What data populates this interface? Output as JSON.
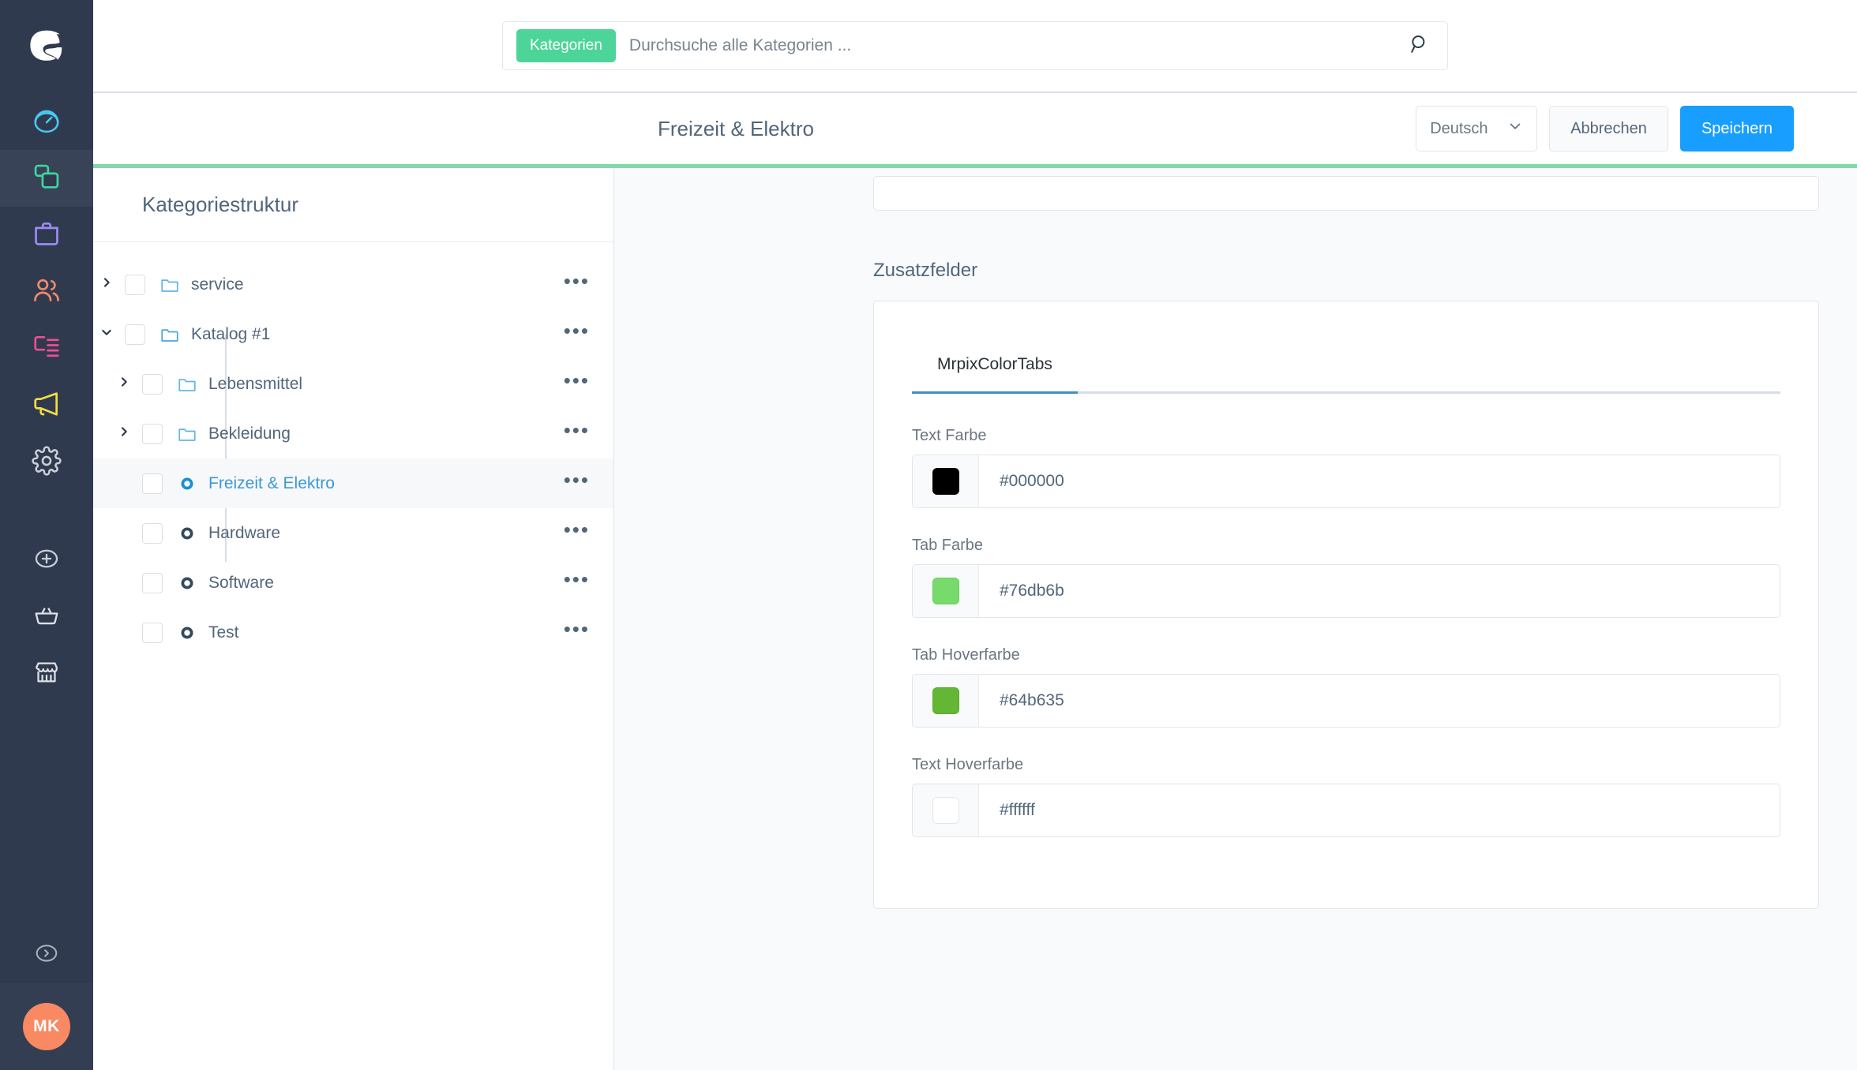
{
  "brand": {
    "logo_name": "shopware-logo",
    "accent_green": "#4dd599",
    "rule_green": "#86d7ac"
  },
  "sidebar": {
    "items": [
      {
        "name": "dashboard",
        "icon": "gauge-icon",
        "color": "#49c8f2",
        "active": false
      },
      {
        "name": "catalogues",
        "icon": "layers-icon",
        "color": "#3fd5a0",
        "active": true
      },
      {
        "name": "orders",
        "icon": "briefcase-icon",
        "color": "#9b8cf5",
        "active": false
      },
      {
        "name": "customers",
        "icon": "users-icon",
        "color": "#ef8b6a",
        "active": false
      },
      {
        "name": "content",
        "icon": "content-icon",
        "color": "#ec4e97",
        "active": false
      },
      {
        "name": "marketing",
        "icon": "megaphone-icon",
        "color": "#f2dd44",
        "active": false
      },
      {
        "name": "settings",
        "icon": "gear-icon",
        "color": "#c9cfd8",
        "active": false
      }
    ],
    "lower_items": [
      {
        "name": "extensions",
        "icon": "plus-circle-icon",
        "color": "#c9cfd8"
      },
      {
        "name": "basket",
        "icon": "basket-icon",
        "color": "#dde2e8"
      },
      {
        "name": "storefront",
        "icon": "shop-icon",
        "color": "#dde2e8"
      }
    ],
    "collapse": {
      "name": "collapse-sidebar",
      "icon": "chevron-right-circle-icon",
      "color": "#aab3c0"
    },
    "avatar": {
      "initials": "MK",
      "color": "#f88962"
    }
  },
  "search": {
    "chip_label": "Kategorien",
    "placeholder": "Durchsuche alle Kategorien ...",
    "value": "",
    "icon": "search-icon"
  },
  "smartbar": {
    "title": "Freizeit & Elektro",
    "language": {
      "value": "Deutsch",
      "caret": "chevron-down-icon"
    },
    "cancel_label": "Abbrechen",
    "save_label": "Speichern"
  },
  "tree": {
    "header_title": "Kategoriestruktur",
    "context_glyph": "•••",
    "rows": [
      {
        "label": "service",
        "depth": 0,
        "caret": "collapsed",
        "icon": "folder-icon",
        "selected": false
      },
      {
        "label": "Katalog #1",
        "depth": 0,
        "caret": "expanded",
        "icon": "folder-open-icon",
        "selected": false
      },
      {
        "label": "Lebensmittel",
        "depth": 1,
        "caret": "collapsed",
        "icon": "folder-icon",
        "selected": false
      },
      {
        "label": "Bekleidung",
        "depth": 1,
        "caret": "collapsed",
        "icon": "folder-icon",
        "selected": false
      },
      {
        "label": "Freizeit & Elektro",
        "depth": 1,
        "caret": "none",
        "icon": "circle-dot-icon",
        "selected": true
      },
      {
        "label": "Hardware",
        "depth": 1,
        "caret": "none",
        "icon": "circle-dot-icon",
        "selected": false
      },
      {
        "label": "Software",
        "depth": 1,
        "caret": "none",
        "icon": "circle-dot-icon",
        "selected": false
      },
      {
        "label": "Test",
        "depth": 1,
        "caret": "none",
        "icon": "circle-dot-icon",
        "selected": false
      }
    ]
  },
  "detail": {
    "section_title": "Zusatzfelder",
    "tabs": [
      {
        "label": "MrpixColorTabs",
        "active": true
      }
    ],
    "fields": [
      {
        "label": "Text Farbe",
        "value": "#000000",
        "swatch": "#000000"
      },
      {
        "label": "Tab Farbe",
        "value": "#76db6b",
        "swatch": "#76db6b"
      },
      {
        "label": "Tab Hoverfarbe",
        "value": "#64b635",
        "swatch": "#64b635"
      },
      {
        "label": "Text Hoverfarbe",
        "value": "#ffffff",
        "swatch": "#ffffff"
      }
    ]
  }
}
